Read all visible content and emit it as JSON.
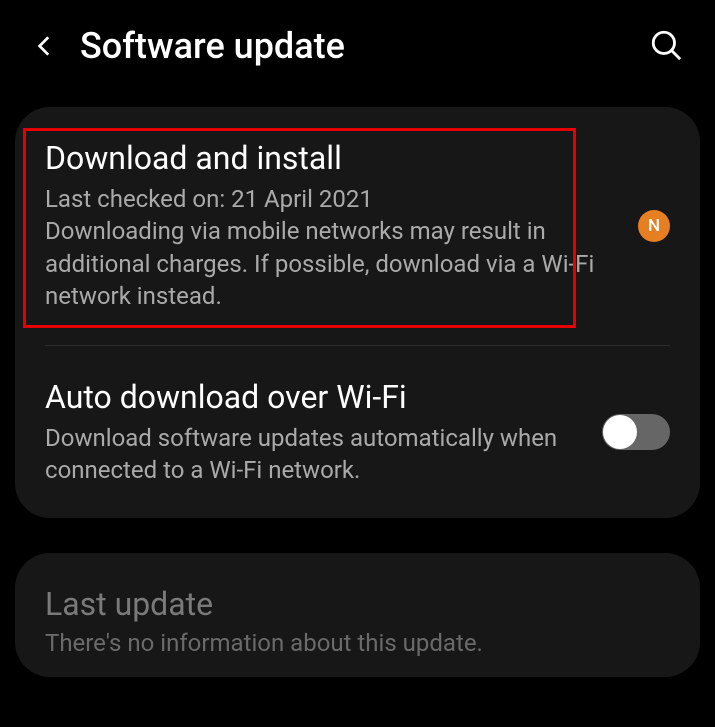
{
  "header": {
    "title": "Software update"
  },
  "download": {
    "title": "Download and install",
    "subtitle": "Last checked on: 21 April 2021\nDownloading via mobile networks may result in additional charges. If possible, download via a Wi-Fi network instead.",
    "badge": "N"
  },
  "auto": {
    "title": "Auto download over Wi-Fi",
    "subtitle": "Download software updates automatically when connected to a Wi-Fi network."
  },
  "last": {
    "title": "Last update",
    "subtitle": "There's no information about this update."
  }
}
